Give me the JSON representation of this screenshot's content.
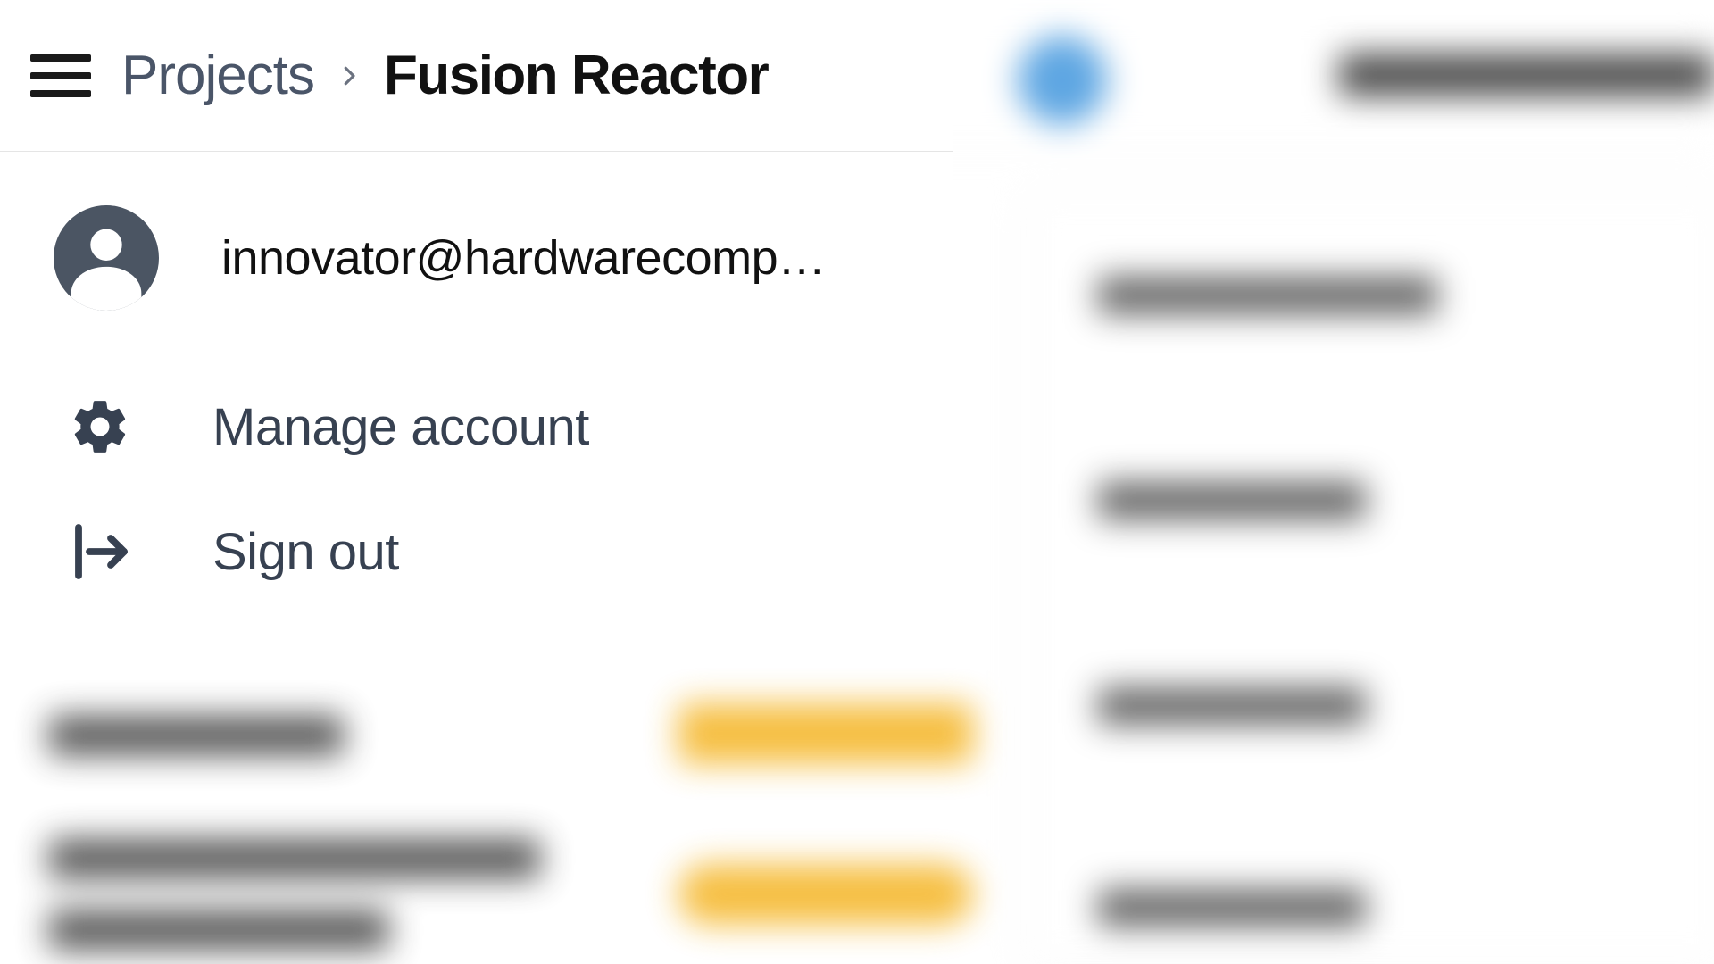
{
  "breadcrumb": {
    "parent": "Projects",
    "current": "Fusion Reactor"
  },
  "user": {
    "email": "innovator@hardwarecomp…"
  },
  "menu": {
    "manage_label": "Manage account",
    "signout_label": "Sign out"
  }
}
